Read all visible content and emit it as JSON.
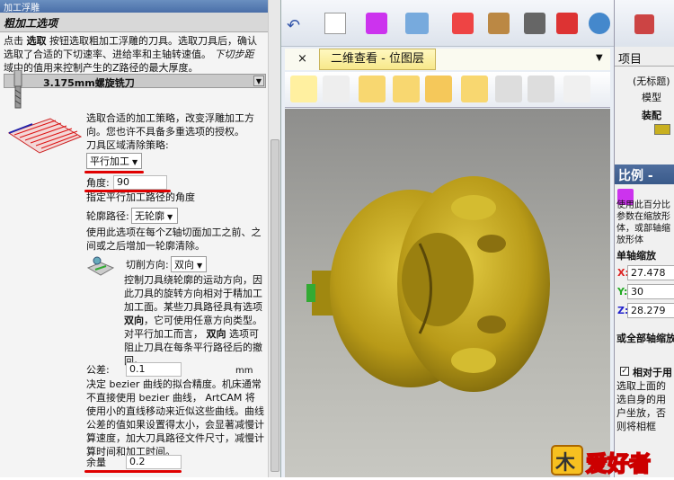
{
  "left_panel": {
    "window_title": "加工浮雕",
    "header": "粗加工选项",
    "intro": {
      "p1": "点击",
      "select_word": "选取",
      "p2": "按钮选取粗加工浮雕的刀具。选取刀具后，确认选取了合适的下切速率、进给率和主轴转速值。",
      "max_depth_word": "下切步距",
      "p3": "域中的值用来控制产生的Z路径的最大厚度。"
    },
    "tool_name": "3.175mm螺旋铣刀",
    "strategy_text": "选取合适的加工策略，改变浮雕加工方向。您也许不具备多重选项的授权。",
    "clear_label": "刀具区域清除策略:",
    "strategy_value": "平行加工",
    "angle_label": "角度:",
    "angle_value": "90",
    "angle_desc": "指定平行加工路径的角度",
    "contour_label": "轮廓路径:",
    "contour_value": "无轮廓",
    "contour_desc": "使用此选项在每个Z轴切面加工之前、之间或之后增加一轮廓清除。",
    "cut_dir_label": "切削方向:",
    "cut_dir_value": "双向",
    "cut_dir_desc_1": "控制刀具绕轮廓的运动方向，因此刀具的旋转方向相对于精加工加工面。某些刀具路径具有选项",
    "cut_dir_bold": "双向",
    "cut_dir_desc_2": "，它可使用任意方向类型。对平行加工而言，",
    "cut_dir_bold_2": "双向",
    "cut_dir_desc_3": "选项可阻止刀具在每条平行路径后的撤回。",
    "tolerance_label": "公差:",
    "tolerance_value": "0.1",
    "tolerance_unit": "mm",
    "tolerance_desc": "决定 bezier 曲线的拟合精度。机床通常不直接使用 bezier 曲线， ArtCAM 将使用小的直线移动来近似这些曲线。曲线公差的值如果设置得太小，会显著减慢计算速度，加大刀具路径文件尺寸，减慢计算时间和加工时间。",
    "allowance_label": "余量",
    "allowance_value": "0.2"
  },
  "center": {
    "tab_label": "二维查看 - 位图层",
    "tab_close": "×",
    "tab_pin": "▼"
  },
  "right_panel": {
    "project_title": "项目",
    "tree_untitled": "(无标题)",
    "tree_model": "模型",
    "tree_assembly": "装配",
    "scale_title": "比例 -",
    "scale_desc": "使用此百分比参数在缩放形体，或部轴缩放形体",
    "single_axis": "单轴缩放",
    "x_label": "X:",
    "x_value": "27.478",
    "y_label": "Y:",
    "y_value": "30",
    "z_label": "Z:",
    "z_value": "28.279",
    "all_axis": "或全部轴缩放",
    "relative_label": "相对于用",
    "relative_desc": "选取上面的选自身的用户坐放，否则将相框 gnomen)",
    "logo_text": "爱好者"
  },
  "colors": {
    "model": "#c9b020",
    "red_mark": "#e00000",
    "tab_bg": "#f7e88a",
    "scale_header": "#3a5a8a"
  }
}
